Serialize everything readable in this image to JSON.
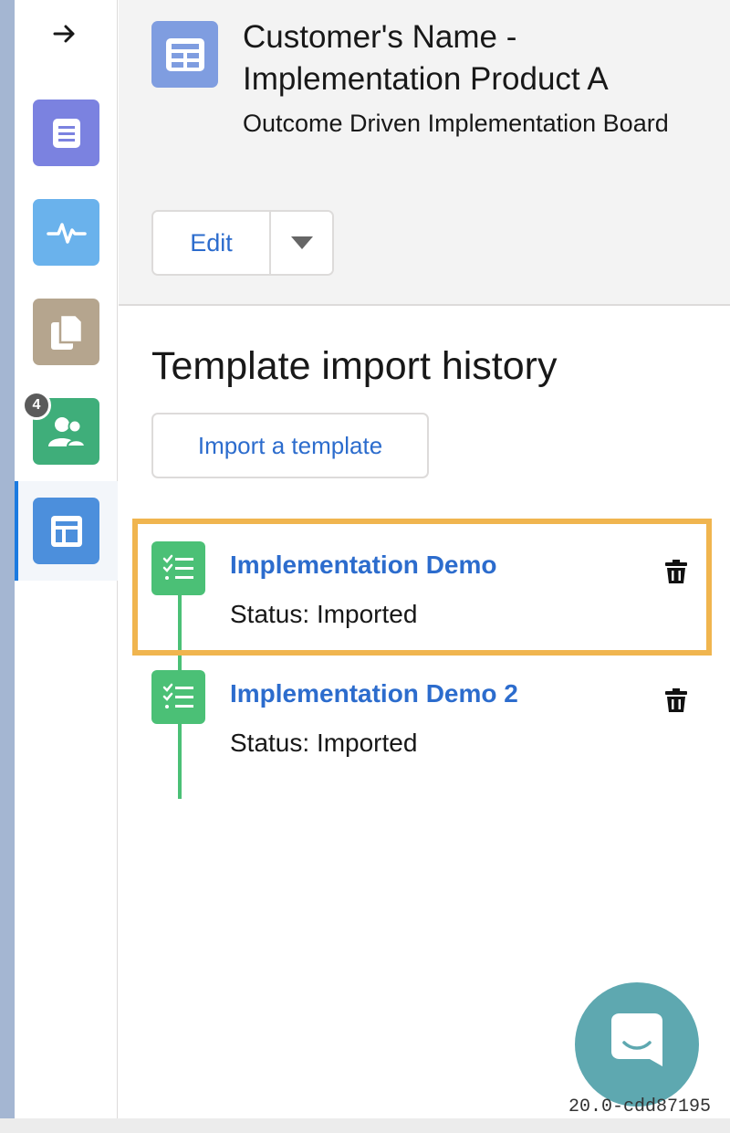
{
  "header": {
    "title": "Customer's Name - Implementation Product A",
    "subtitle": "Outcome Driven Implementation Board",
    "edit_label": "Edit"
  },
  "rail": {
    "items": [
      {
        "icon": "list-icon",
        "color": "#7b82e0"
      },
      {
        "icon": "pulse-icon",
        "color": "#6ab2ec"
      },
      {
        "icon": "copy-icon",
        "color": "#b5a58e"
      },
      {
        "icon": "contacts-icon",
        "color": "#3fae7a",
        "badge": "4"
      },
      {
        "icon": "layout-icon",
        "color": "#4c8fdc",
        "active": true
      }
    ]
  },
  "section": {
    "title": "Template import history",
    "import_label": "Import a template"
  },
  "history": [
    {
      "title": "Implementation Demo",
      "status": "Status: Imported",
      "highlighted": true
    },
    {
      "title": "Implementation Demo 2",
      "status": "Status: Imported"
    }
  ],
  "footer": {
    "version": "20.0-cdd87195"
  },
  "colors": {
    "accent": "#2c6ccd",
    "timeline": "#4bc076",
    "highlight": "#f0b54f"
  }
}
